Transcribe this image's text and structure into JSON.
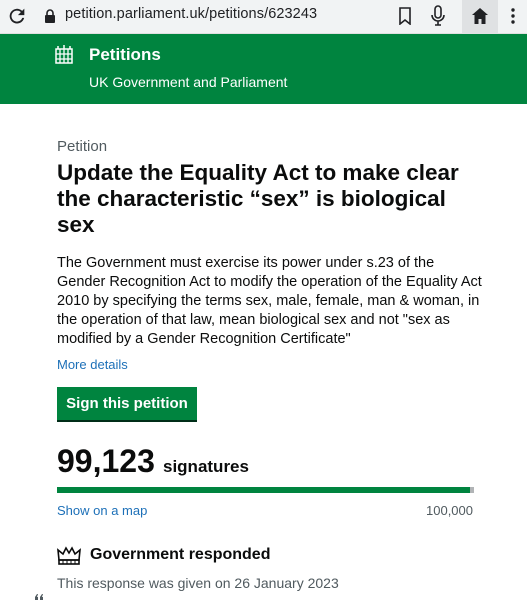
{
  "browser": {
    "url": "petition.parliament.uk/petitions/623243",
    "icons": [
      "reload-icon",
      "lock-icon",
      "bookmark-icon",
      "mic-icon",
      "home-icon",
      "menu-dots-icon"
    ]
  },
  "header": {
    "title": "Petitions",
    "subtitle": "UK Government and Parliament",
    "icon": "portcullis-icon"
  },
  "petition": {
    "caption": "Petition",
    "title": "Update the Equality Act to make clear the characteristic “sex” is biological sex",
    "body": "The Government must exercise its power under s.23 of the Gender Recognition Act to modify the operation of the Equality Act 2010 by specifying the terms sex, male, female, man & woman, in the operation of that law, mean biological sex and not \"sex as modified by a Gender Recognition Certificate\"",
    "more_details": "More details",
    "sign_button": "Sign this petition"
  },
  "signatures": {
    "count": "99,123",
    "label": "signatures",
    "progress_fraction": 0.99123,
    "show_map": "Show on a map",
    "target": "100,000"
  },
  "response": {
    "heading": "Government responded",
    "date_text": "This response was given on 26 January 2023",
    "icon": "crown-icon"
  },
  "colors": {
    "brand_green": "#00843f",
    "link_blue": "#1d70b8",
    "muted_text": "#505a5f"
  }
}
